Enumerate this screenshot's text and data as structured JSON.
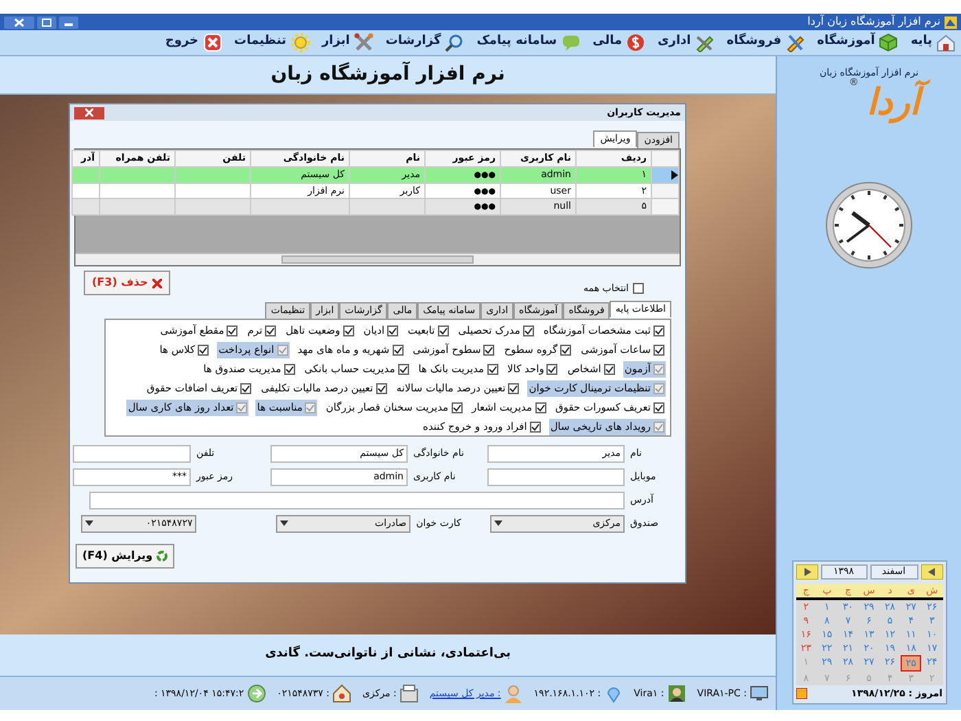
{
  "window": {
    "title": "نرم افزار آموزشگاه زبان  آردا"
  },
  "menu": [
    {
      "label": "پایه",
      "kind": "base"
    },
    {
      "label": "آموزشگاه",
      "kind": "school"
    },
    {
      "label": "فروشگاه",
      "kind": "shop"
    },
    {
      "label": "اداری",
      "kind": "office"
    },
    {
      "label": "مالی",
      "kind": "finance"
    },
    {
      "label": "سامانه پیامک",
      "kind": "sms"
    },
    {
      "label": "گزارشات",
      "kind": "reports"
    },
    {
      "label": "ابزار",
      "kind": "tools"
    },
    {
      "label": "تنظیمات",
      "kind": "settings"
    },
    {
      "label": "خروج",
      "kind": "exit"
    }
  ],
  "header": {
    "title": "نرم افزار آموزشگاه زبان"
  },
  "sidebar": {
    "caption": "نرم افزار آموزشگاه زبان",
    "logo": "آردا",
    "logo_mark": "®",
    "calendar": {
      "month": "اسفند",
      "year": "۱۳۹۸",
      "weekdays": [
        "ش",
        "ی",
        "د",
        "س",
        "چ",
        "پ",
        "ج"
      ],
      "weeks": [
        [
          {
            "day": "۲۶",
            "kind": "normal",
            "selected": false
          },
          {
            "day": "۲۷",
            "kind": "normal",
            "selected": false
          },
          {
            "day": "۲۸",
            "kind": "normal",
            "selected": false
          },
          {
            "day": "۲۹",
            "kind": "normal",
            "selected": false
          },
          {
            "day": "۳۰",
            "kind": "normal",
            "selected": false
          },
          {
            "day": "۱",
            "kind": "normal",
            "selected": false
          },
          {
            "day": "۲",
            "kind": "holiday",
            "selected": false
          }
        ],
        [
          {
            "day": "۳",
            "kind": "normal",
            "selected": false
          },
          {
            "day": "۴",
            "kind": "normal",
            "selected": false
          },
          {
            "day": "۵",
            "kind": "normal",
            "selected": false
          },
          {
            "day": "۶",
            "kind": "normal",
            "selected": false
          },
          {
            "day": "۷",
            "kind": "normal",
            "selected": false
          },
          {
            "day": "۸",
            "kind": "normal",
            "selected": false
          },
          {
            "day": "۹",
            "kind": "holiday",
            "selected": false
          }
        ],
        [
          {
            "day": "۱۰",
            "kind": "normal",
            "selected": false
          },
          {
            "day": "۱۱",
            "kind": "normal",
            "selected": false
          },
          {
            "day": "۱۲",
            "kind": "normal",
            "selected": false
          },
          {
            "day": "۱۳",
            "kind": "normal",
            "selected": false
          },
          {
            "day": "۱۴",
            "kind": "normal",
            "selected": false
          },
          {
            "day": "۱۵",
            "kind": "normal",
            "selected": false
          },
          {
            "day": "۱۶",
            "kind": "holiday",
            "selected": false
          }
        ],
        [
          {
            "day": "۱۷",
            "kind": "normal",
            "selected": false
          },
          {
            "day": "۱۸",
            "kind": "normal",
            "selected": false
          },
          {
            "day": "۱۹",
            "kind": "normal",
            "selected": false
          },
          {
            "day": "۲۰",
            "kind": "normal",
            "selected": false
          },
          {
            "day": "۲۱",
            "kind": "normal",
            "selected": false
          },
          {
            "day": "۲۲",
            "kind": "normal",
            "selected": false
          },
          {
            "day": "۲۳",
            "kind": "holiday",
            "selected": false
          }
        ],
        [
          {
            "day": "۲۴",
            "kind": "normal",
            "selected": false
          },
          {
            "day": "۲۵",
            "kind": "normal",
            "selected": true
          },
          {
            "day": "۲۶",
            "kind": "normal",
            "selected": false
          },
          {
            "day": "۲۷",
            "kind": "normal",
            "selected": false
          },
          {
            "day": "۲۸",
            "kind": "normal",
            "selected": false
          },
          {
            "day": "۲۹",
            "kind": "normal",
            "selected": false
          },
          {
            "day": "۱",
            "kind": "other",
            "selected": false
          }
        ],
        [
          {
            "day": "۲",
            "kind": "other",
            "selected": false
          },
          {
            "day": "۳",
            "kind": "other",
            "selected": false
          },
          {
            "day": "۴",
            "kind": "other",
            "selected": false
          },
          {
            "day": "۵",
            "kind": "other",
            "selected": false
          },
          {
            "day": "۶",
            "kind": "other",
            "selected": false
          },
          {
            "day": "۷",
            "kind": "other",
            "selected": false
          },
          {
            "day": "۸",
            "kind": "other",
            "selected": false
          }
        ]
      ],
      "today": "امروز : ۱۳۹۸/۱۲/۲۵"
    }
  },
  "dialog": {
    "title": "مدیریت کاربران",
    "tabs": [
      {
        "label": "افزودن",
        "selected": false
      },
      {
        "label": "ویرایش",
        "selected": true
      }
    ],
    "table": {
      "columns": [
        "ردیف",
        "نام کاربری",
        "رمز عبور",
        "نام",
        "نام خانوادگی",
        "تلفن",
        "تلفن همراه",
        "آدر"
      ],
      "rows": [
        {
          "cells": [
            "۱",
            "admin",
            "●●●",
            "مدیر",
            "کل سیستم"
          ],
          "selected": true
        },
        {
          "cells": [
            "۲",
            "user",
            "●●●",
            "کاربر",
            "نرم افزار"
          ],
          "selected": false
        },
        {
          "cells": [
            "۵",
            "null",
            "●●●"
          ],
          "selected": false
        }
      ]
    },
    "delete_button": "حذف (F3)",
    "select_all": {
      "label": "انتخاب همه",
      "checked": false
    },
    "permission_tabs": [
      {
        "label": "اطلاعات پایه",
        "selected": true
      },
      {
        "label": "فروشگاه",
        "selected": false
      },
      {
        "label": "آموزشگاه",
        "selected": false
      },
      {
        "label": "اداری",
        "selected": false
      },
      {
        "label": "سامانه پیامک",
        "selected": false
      },
      {
        "label": "مالی",
        "selected": false
      },
      {
        "label": "گزارشات",
        "selected": false
      },
      {
        "label": "ابزار",
        "selected": false
      },
      {
        "label": "تنظیمات",
        "selected": false
      }
    ],
    "permissions": [
      [
        {
          "label": "ثبت مشخصات آموزشگاه",
          "checked": true,
          "highlighted": false
        },
        {
          "label": "مدرک تحصیلی",
          "checked": true,
          "highlighted": false
        },
        {
          "label": "تابعیت",
          "checked": true,
          "highlighted": false
        },
        {
          "label": "ادیان",
          "checked": true,
          "highlighted": false
        },
        {
          "label": "وضعیت تاهل",
          "checked": true,
          "highlighted": false
        },
        {
          "label": "ترم",
          "checked": true,
          "highlighted": false
        },
        {
          "label": "مقطع آموزشی",
          "checked": true,
          "highlighted": false
        }
      ],
      [
        {
          "label": "ساعات آموزشی",
          "checked": true,
          "highlighted": false
        },
        {
          "label": "گروه سطوح",
          "checked": true,
          "highlighted": false
        },
        {
          "label": "سطوح آموزشی",
          "checked": true,
          "highlighted": false
        },
        {
          "label": "شهریه و ماه های مهد",
          "checked": true,
          "highlighted": false
        },
        {
          "label": "انواع پرداخت",
          "checked": true,
          "highlighted": true
        },
        {
          "label": "کلاس ها",
          "checked": true,
          "highlighted": false
        }
      ],
      [
        {
          "label": "آزمون",
          "checked": true,
          "highlighted": true
        },
        {
          "label": "اشخاص",
          "checked": true,
          "highlighted": false
        },
        {
          "label": "واحد کالا",
          "checked": true,
          "highlighted": false
        },
        {
          "label": "مدیریت بانک ها",
          "checked": true,
          "highlighted": false
        },
        {
          "label": "مدیریت حساب بانکی",
          "checked": true,
          "highlighted": false
        },
        {
          "label": "مدیریت صندوق ها",
          "checked": true,
          "highlighted": false
        }
      ],
      [
        {
          "label": "تنظیمات ترمینال کارت خوان",
          "checked": true,
          "highlighted": true
        },
        {
          "label": "تعیین درصد مالیات سالانه",
          "checked": true,
          "highlighted": false
        },
        {
          "label": "تعیین درصد مالیات تکلیفی",
          "checked": true,
          "highlighted": false
        },
        {
          "label": "تعریف اضافات حقوق",
          "checked": true,
          "highlighted": false
        }
      ],
      [
        {
          "label": "تعریف کسورات حقوق",
          "checked": true,
          "highlighted": false
        },
        {
          "label": "مدیریت اشعار",
          "checked": true,
          "highlighted": false
        },
        {
          "label": "مدیریت سخنان قصار بزرگان",
          "checked": true,
          "highlighted": false
        },
        {
          "label": "مناسبت ها",
          "checked": true,
          "highlighted": true
        },
        {
          "label": "تعداد روز های کاری سال",
          "checked": true,
          "highlighted": true
        }
      ],
      [
        {
          "label": "رویداد های تاریخی سال",
          "checked": true,
          "highlighted": true
        },
        {
          "label": "افراد ورود و خروج کننده",
          "checked": true,
          "highlighted": false
        }
      ]
    ],
    "form": [
      [
        {
          "label": "نام",
          "value": "مدیر",
          "kind": "text"
        },
        {
          "label": "نام خانوادگی",
          "value": "کل سیستم",
          "kind": "text"
        },
        {
          "label": "تلفن",
          "kind": "text"
        }
      ],
      [
        {
          "label": "موبایل",
          "kind": "text"
        },
        {
          "label": "نام کاربری",
          "value": "admin",
          "kind": "text"
        },
        {
          "label": "رمز عبور",
          "value": "***",
          "kind": "text"
        }
      ],
      [
        {
          "label": "آدرس",
          "kind": "wide"
        }
      ],
      [
        {
          "label": "صندوق",
          "value": "مرکزی",
          "kind": "dropdown"
        },
        {
          "label": "کارت خوان",
          "value": "صادرات",
          "kind": "dropdown"
        },
        {
          "value": "۰۲۱۵۴۸۷۲۷",
          "kind": "dropdown"
        }
      ]
    ],
    "edit_button": "ویرایش (F4)"
  },
  "quote": "بی‌اعتمادی، نشانی از ناتوانی‌ست. گاندی",
  "status_bar": [
    {
      "text": ": VIRA۱-PC",
      "kind": "computer"
    },
    {
      "text": ": Vira۱",
      "kind": "user-card"
    },
    {
      "text": ": ۱۹۲.۱۶۸.۱.۱۰۲",
      "kind": "pin"
    },
    {
      "text": ": مدیر کل سیستم",
      "kind": "person"
    },
    {
      "text": ": مرکزی",
      "kind": "fax"
    },
    {
      "text": ": ۰۲۱۵۴۸۷۳۷",
      "kind": "house"
    },
    {
      "text": "۱۵:۴۷:۲ ۱۳۹۸/۱۲/۰۴ :",
      "kind": "clock"
    }
  ]
}
